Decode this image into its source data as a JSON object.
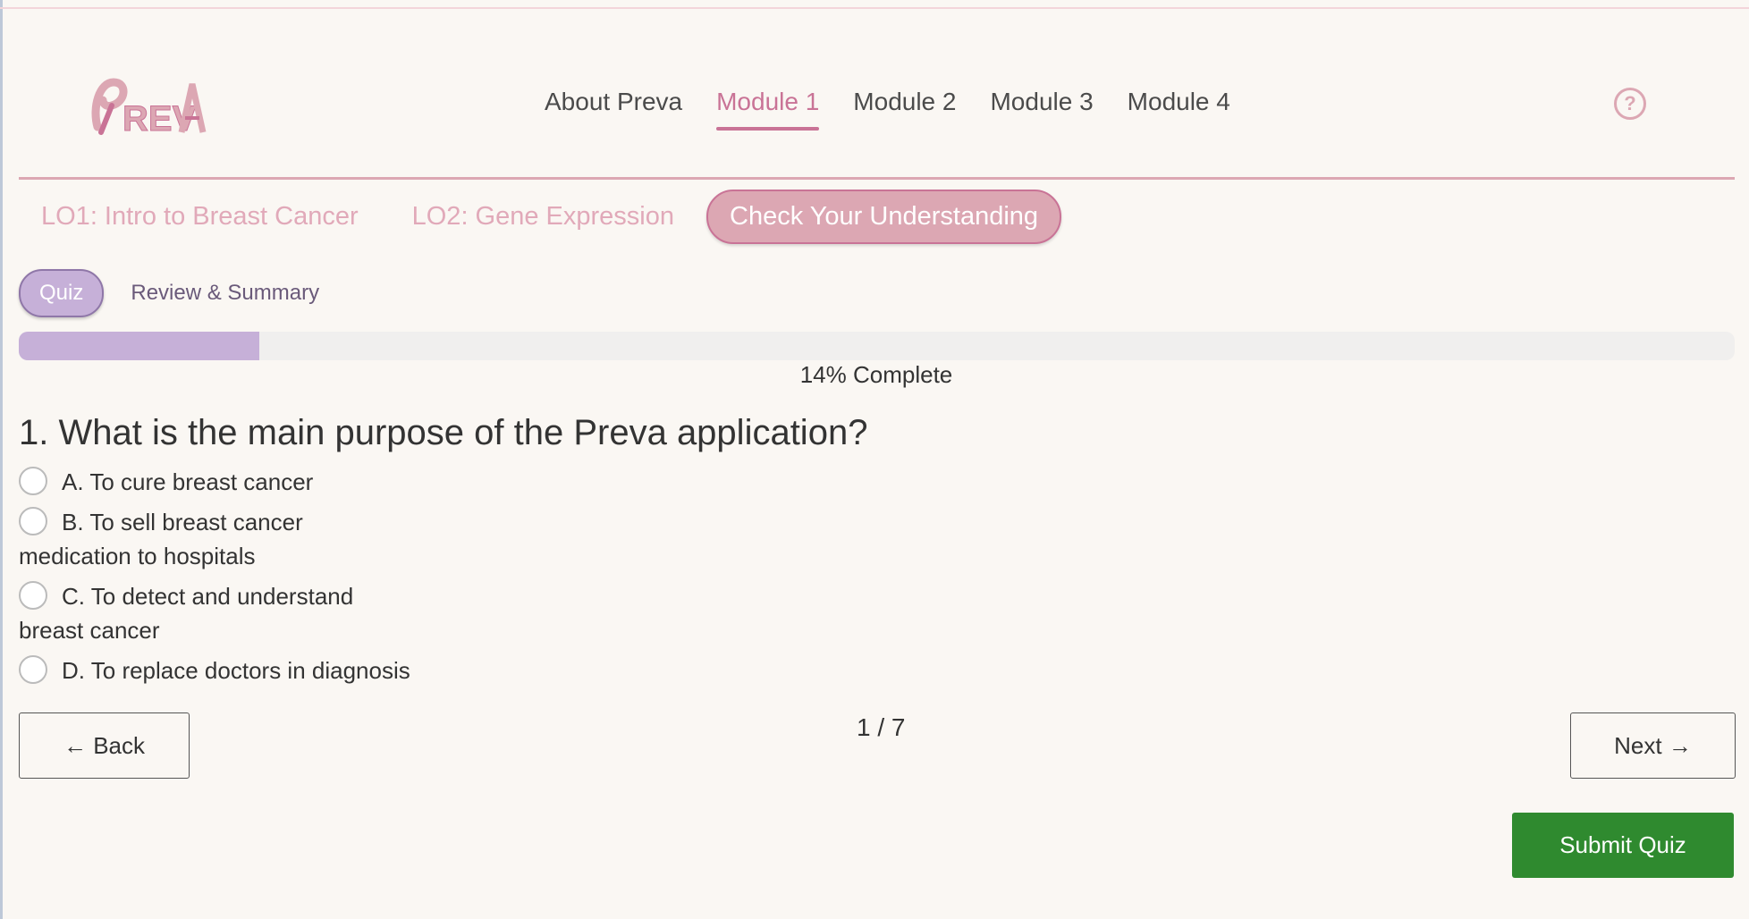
{
  "brand": {
    "logo_text": "PREVA",
    "accent": "#c97396",
    "pink": "#dca7b3",
    "lavender": "#c6b0d8",
    "success": "#2f8a2f"
  },
  "nav": {
    "items": [
      {
        "label": "About Preva",
        "active": false
      },
      {
        "label": "Module 1",
        "active": true
      },
      {
        "label": "Module 2",
        "active": false
      },
      {
        "label": "Module 3",
        "active": false
      },
      {
        "label": "Module 4",
        "active": false
      }
    ],
    "help_icon": "question-circle-icon"
  },
  "lo_tabs": [
    {
      "label": "LO1: Intro to Breast Cancer"
    },
    {
      "label": "LO2: Gene Expression"
    },
    {
      "label": "Check Your Understanding"
    }
  ],
  "sub_tabs": [
    {
      "label": "Quiz"
    },
    {
      "label": "Review & Summary"
    }
  ],
  "progress": {
    "percent": 14,
    "text": "14% Complete"
  },
  "question": {
    "text": "1. What is the main purpose of the Preva application?",
    "options": [
      "A. To cure breast cancer",
      "B. To sell breast cancer medication to hospitals",
      "C. To detect and understand breast cancer",
      "D. To replace doctors in diagnosis"
    ]
  },
  "pagination": {
    "back_label": "← Back",
    "next_label": "Next →",
    "indicator": "1 / 7"
  },
  "submit_label": "Submit Quiz"
}
